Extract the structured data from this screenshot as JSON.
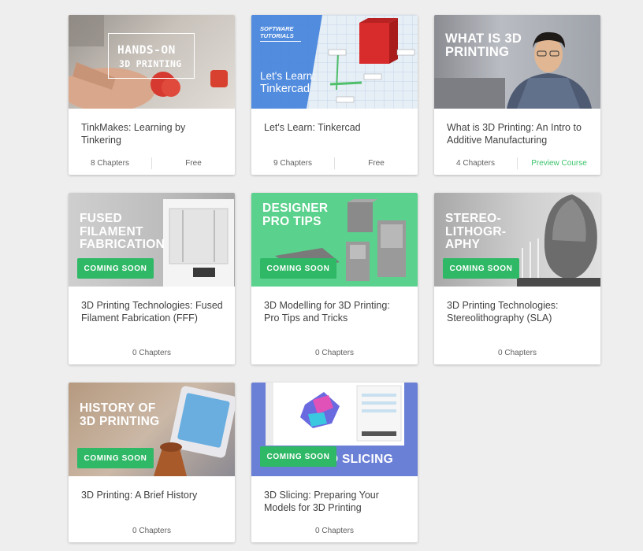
{
  "courses": [
    {
      "thumb_lines": [
        "HANDS-ON",
        "3D PRINTING"
      ],
      "title": "TinkMakes: Learning by Tinkering",
      "chapters": "8 Chapters",
      "price": "Free"
    },
    {
      "thumb_kicker": "SOFTWARE TUTORIALS",
      "thumb_lines": [
        "Let's Learn:",
        "Tinkercad"
      ],
      "title": "Let's Learn: Tinkercad",
      "chapters": "9 Chapters",
      "price": "Free"
    },
    {
      "thumb_text": "WHAT IS 3D\nPRINTING",
      "title": "What is 3D Printing: An Intro to Additive Manufacturing",
      "chapters": "4 Chapters",
      "price": "Preview Course"
    },
    {
      "thumb_text": "FUSED\nFILAMENT\nFABRICATION",
      "badge": "COMING SOON",
      "title": "3D Printing Technologies: Fused Filament Fabrication (FFF)",
      "chapters": "0 Chapters"
    },
    {
      "thumb_text": "DESIGNER\nPRO TIPS",
      "badge": "COMING SOON",
      "title": "3D Modelling for 3D Printing: Pro Tips and Tricks",
      "chapters": "0 Chapters"
    },
    {
      "thumb_text": "STEREO-\nLITHOGR-\nAPHY",
      "badge": "COMING SOON",
      "title": "3D Printing Technologies: Stereolithography (SLA)",
      "chapters": "0 Chapters"
    },
    {
      "thumb_text": "HISTORY OF\n3D PRINTING",
      "badge": "COMING SOON",
      "title": "3D Printing: A Brief History",
      "chapters": "0 Chapters"
    },
    {
      "thumb_text": "3D SLICING",
      "badge": "COMING SOON",
      "title": "3D Slicing: Preparing Your Models for 3D Printing",
      "chapters": "0 Chapters"
    }
  ],
  "colors": {
    "accent_green": "#2fb866",
    "preview_link": "#3cc36a",
    "tinkercad_blue": "#4a86dc"
  }
}
